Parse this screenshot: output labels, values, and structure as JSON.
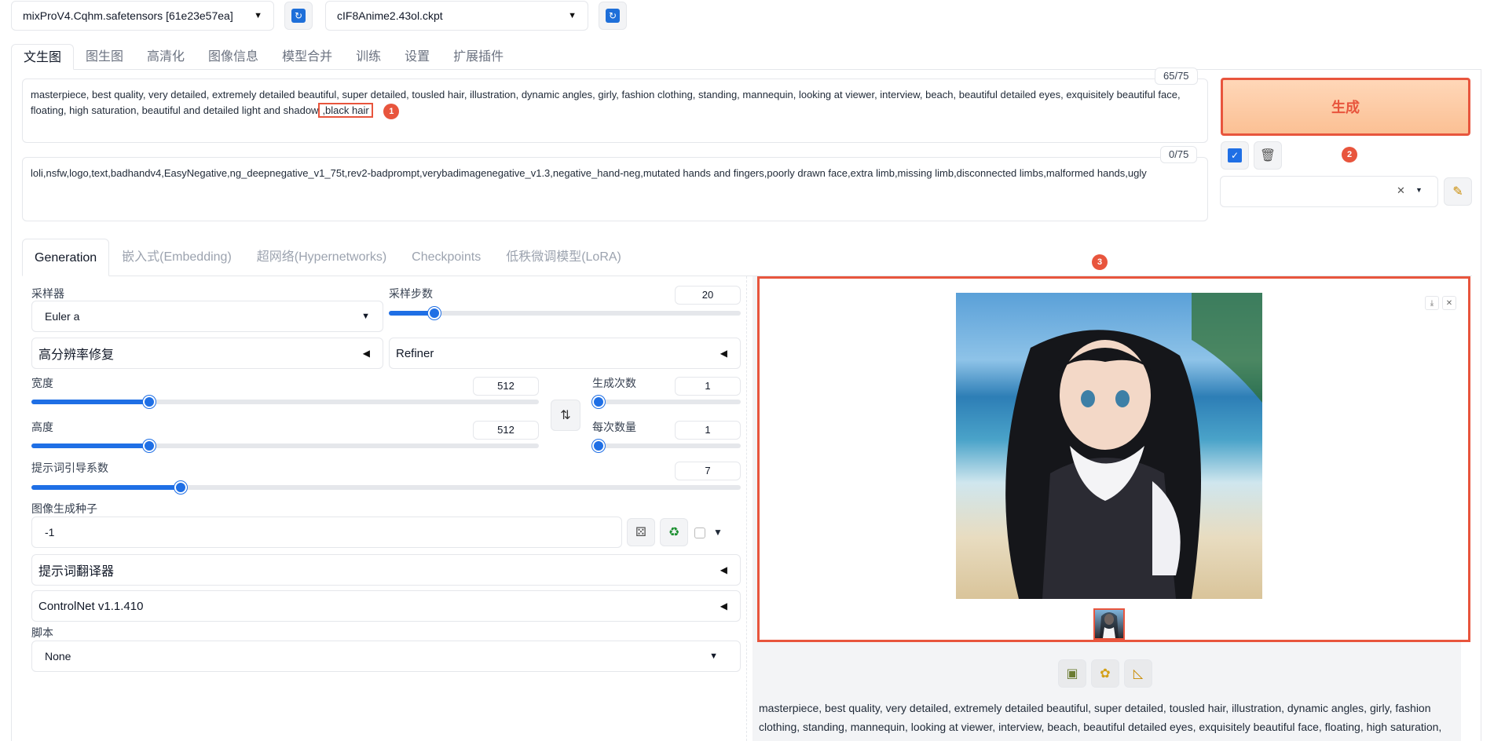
{
  "models": {
    "checkpoint": "mixProV4.Cqhm.safetensors [61e23e57ea]",
    "vae": "cIF8Anime2.43ol.ckpt"
  },
  "main_tabs": [
    "文生图",
    "图生图",
    "高清化",
    "图像信息",
    "模型合并",
    "训练",
    "设置",
    "扩展插件"
  ],
  "prompt": {
    "text_before": "masterpiece, best quality, very detailed, extremely detailed beautiful, super detailed, tousled hair, illustration, dynamic angles, girly, fashion clothing, standing, mannequin, looking at viewer, interview, beach, beautiful detailed eyes, exquisitely beautiful face, floating, high saturation, beautiful and detailed light and shadow",
    "highlighted": ",black hair",
    "counter": "65/75"
  },
  "negative_prompt": {
    "text": "loli,nsfw,logo,text,badhandv4,EasyNegative,ng_deepnegative_v1_75t,rev2-badprompt,verybadimagenegative_v1.3,negative_hand-neg,mutated hands and fingers,poorly drawn face,extra limb,missing limb,disconnected limbs,malformed hands,ugly",
    "counter": "0/75"
  },
  "badges": {
    "one": "1",
    "two": "2",
    "three": "3"
  },
  "generate_label": "生成",
  "sub_tabs": [
    "Generation",
    "嵌入式(Embedding)",
    "超网络(Hypernetworks)",
    "Checkpoints",
    "低秩微调模型(LoRA)"
  ],
  "settings": {
    "sampler_label": "采样器",
    "sampler_value": "Euler a",
    "steps_label": "采样步数",
    "steps_value": "20",
    "steps_fraction": 0.13,
    "hires_label": "高分辨率修复",
    "refiner_label": "Refiner",
    "width_label": "宽度",
    "width_value": "512",
    "width_fraction": 0.232,
    "height_label": "高度",
    "height_value": "512",
    "height_fraction": 0.232,
    "batch_count_label": "生成次数",
    "batch_count_value": "1",
    "batch_count_fraction": 0.0,
    "batch_size_label": "每次数量",
    "batch_size_value": "1",
    "batch_size_fraction": 0.0,
    "cfg_label": "提示词引导系数",
    "cfg_value": "7",
    "cfg_fraction": 0.21,
    "seed_label": "图像生成种子",
    "seed_value": "-1",
    "translator_label": "提示词翻译器",
    "controlnet_label": "ControlNet v1.1.410",
    "script_label": "脚本",
    "script_value": "None"
  },
  "output": {
    "caption": "masterpiece, best quality, very detailed, extremely detailed beautiful, super detailed, tousled hair, illustration, dynamic angles, girly, fashion clothing, standing, mannequin, looking at viewer, interview, beach, beautiful detailed eyes, exquisitely beautiful face, floating, high saturation, beautiful and"
  },
  "colors": {
    "accent": "#e8553d",
    "slider": "#1f6fe5",
    "generate_bg": "#fbc094"
  }
}
